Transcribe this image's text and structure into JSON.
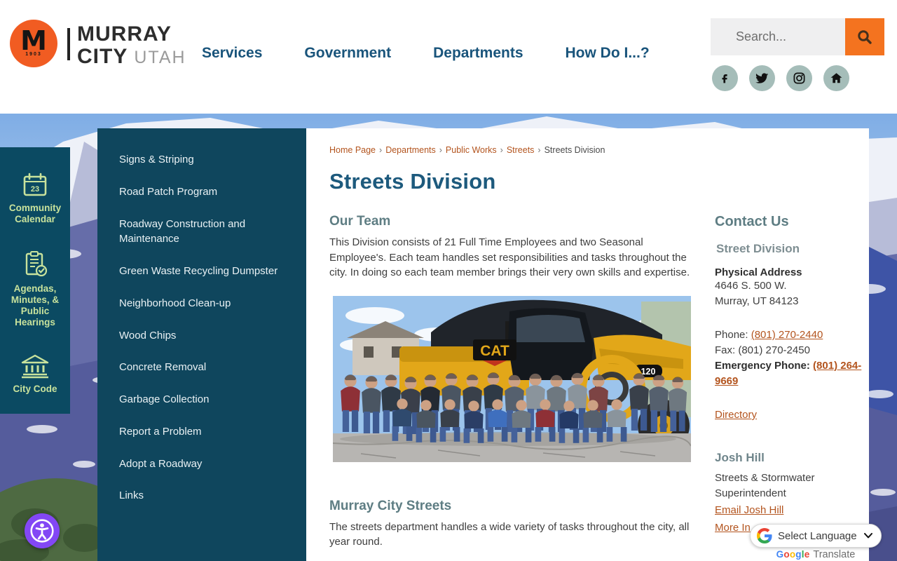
{
  "header": {
    "logo": {
      "monogram": "M",
      "year": "1903",
      "name_line1": "MURRAY",
      "name_line2": "CITY",
      "state": "UTAH"
    },
    "nav": [
      {
        "label": "Services"
      },
      {
        "label": "Government"
      },
      {
        "label": "Departments"
      },
      {
        "label": "How Do I...?"
      }
    ],
    "search": {
      "placeholder": "Search..."
    }
  },
  "quick_links": {
    "calendar_day": "23",
    "items": [
      {
        "label": "Community Calendar"
      },
      {
        "label": "Agendas, Minutes, & Public Hearings"
      },
      {
        "label": "City Code"
      }
    ]
  },
  "sidebar": {
    "items": [
      "Signs & Striping",
      "Road Patch Program",
      "Roadway Construction and Maintenance",
      "Green Waste Recycling Dumpster",
      "Neighborhood Clean-up",
      "Wood Chips",
      "Concrete Removal",
      "Garbage Collection",
      "Report a Problem",
      "Adopt a Roadway",
      "Links"
    ]
  },
  "breadcrumb": {
    "separator": "›",
    "items": [
      {
        "label": "Home Page"
      },
      {
        "label": "Departments"
      },
      {
        "label": "Public Works"
      },
      {
        "label": "Streets"
      },
      {
        "label": "Streets Division"
      }
    ]
  },
  "main": {
    "title": "Streets Division",
    "section1_heading": "Our Team",
    "section1_body": "This Division consists of 21 Full Time Employees and two Seasonal Employee's. Each team handles set responsibilities and tasks throughout the city. In doing so each team member brings their very own skills and expertise.",
    "section2_heading": "Murray City Streets",
    "section2_body": "The streets department handles a wide variety of tasks throughout the city, all year round.",
    "photo_labels": {
      "brand": "CAT",
      "model": "120"
    }
  },
  "contact": {
    "heading": "Contact Us",
    "division": "Street Division",
    "address_label": "Physical Address",
    "address_line1": "4646 S. 500 W.",
    "address_line2": "Murray, UT 84123",
    "phone_label": "Phone:",
    "phone": "(801) 270-2440",
    "fax_line": "Fax: (801) 270-2450",
    "emergency_label": "Emergency Phone:",
    "emergency_phone": "(801) 264-9669",
    "directory": "Directory",
    "person_name": "Josh Hill",
    "person_title_line1": "Streets & Stormwater",
    "person_title_line2": "Superintendent",
    "email_link": "Email Josh Hill",
    "more_link": "More In"
  },
  "translate": {
    "select_label": "Select Language",
    "brand_letters": [
      "G",
      "o",
      "o",
      "g",
      "l",
      "e"
    ],
    "brand_suffix": "Translate"
  },
  "colors": {
    "accent_orange": "#f15c22",
    "nav_blue": "#19547b",
    "panel_teal": "#0b4a62",
    "sidebar_teal": "#0f465d",
    "link_orange": "#b3541e",
    "quick_text_green": "#c8e29c",
    "heading_blue": "#1d5a7d",
    "section_gray_teal": "#5e7d83"
  }
}
